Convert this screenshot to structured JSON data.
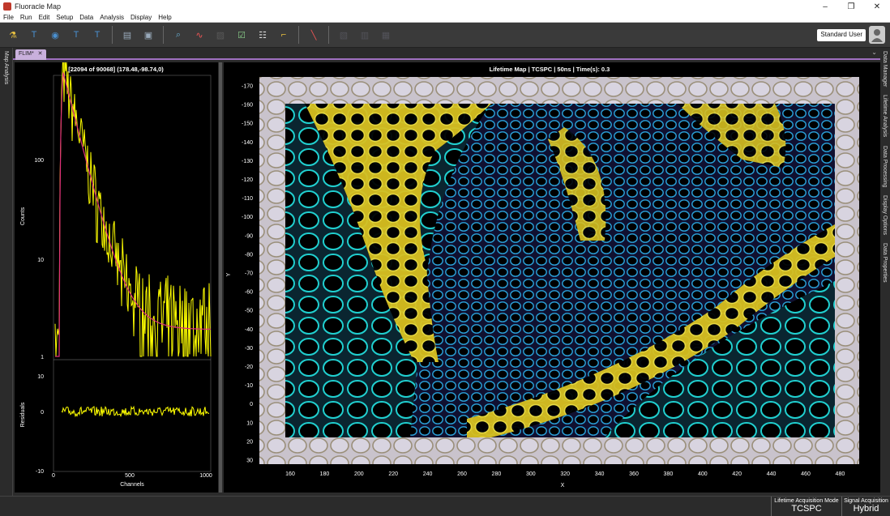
{
  "window": {
    "title": "Fluoracle Map"
  },
  "menu": [
    "File",
    "Run",
    "Edit",
    "Setup",
    "Data",
    "Analysis",
    "Display",
    "Help"
  ],
  "toolbar": {
    "user_label": "Standard User",
    "tools": [
      {
        "icon": "microscope-icon",
        "glyph": "⚗",
        "color": "#e8c040"
      },
      {
        "icon": "timer-t-icon",
        "glyph": "T",
        "color": "#4a90d0"
      },
      {
        "icon": "timer-record-icon",
        "glyph": "◉",
        "color": "#4a90d0"
      },
      {
        "icon": "timer-t2-icon",
        "glyph": "T",
        "color": "#4a90d0"
      },
      {
        "icon": "timer-t3-icon",
        "glyph": "T",
        "color": "#4a90d0"
      },
      {
        "sep": true
      },
      {
        "icon": "open-folder-icon",
        "glyph": "▤",
        "color": "#9ab"
      },
      {
        "icon": "save-disk-icon",
        "glyph": "▣",
        "color": "#9ab"
      },
      {
        "sep": true
      },
      {
        "icon": "zoom-search-icon",
        "glyph": "⌕",
        "color": "#6ac"
      },
      {
        "icon": "decay-fit-icon",
        "glyph": "∿",
        "color": "#e55"
      },
      {
        "icon": "chart-dim-icon",
        "glyph": "▨",
        "color": "#888",
        "dim": true
      },
      {
        "icon": "checklist-icon",
        "glyph": "☑",
        "color": "#8c8"
      },
      {
        "icon": "table-icon",
        "glyph": "☷",
        "color": "#ddd"
      },
      {
        "icon": "crop-icon",
        "glyph": "⌐",
        "color": "#e8c040"
      },
      {
        "sep": true
      },
      {
        "icon": "decay-curve-icon",
        "glyph": "╲",
        "color": "#e55"
      },
      {
        "sep": true
      },
      {
        "icon": "layer-1-icon",
        "glyph": "▧",
        "color": "#778",
        "dim": true
      },
      {
        "icon": "layer-2-icon",
        "glyph": "▥",
        "color": "#778",
        "dim": true
      },
      {
        "icon": "layer-3-icon",
        "glyph": "▦",
        "color": "#778",
        "dim": true
      }
    ]
  },
  "left_rail": {
    "label": "Map Analysis"
  },
  "right_rail": [
    "Data Manager",
    "Lifetime Analysis",
    "Data Processing",
    "Display Options",
    "Data Properties"
  ],
  "tab": {
    "label": "FLIM*",
    "close": "✕",
    "chevron": "⌄"
  },
  "decay_plot": {
    "title": "[22094 of 90068] (178.48,-98.74,0)",
    "ylabel": "Counts",
    "residual_label": "Residuals",
    "xlabel": "Channels",
    "y_ticks": [
      "100",
      "10",
      "1"
    ],
    "res_ticks": [
      "10",
      "0",
      "-10"
    ],
    "x_ticks": [
      "0",
      "500",
      "1000"
    ]
  },
  "map_plot": {
    "title": "Lifetime Map | TCSPC | 50ns | Time(s): 0.3",
    "xlabel": "X",
    "ylabel": "Y",
    "y_ticks": [
      "-170",
      "-160",
      "-150",
      "-140",
      "-130",
      "-120",
      "-110",
      "-100",
      "-90",
      "-80",
      "-70",
      "-60",
      "-50",
      "-40",
      "-30",
      "-20",
      "-10",
      "0",
      "10",
      "20",
      "30"
    ],
    "x_ticks": [
      "160",
      "180",
      "200",
      "220",
      "240",
      "260",
      "280",
      "300",
      "320",
      "340",
      "360",
      "380",
      "400",
      "420",
      "440",
      "460",
      "480"
    ]
  },
  "status": {
    "mode_label": "Lifetime Acquisition Mode",
    "mode_value": "TCSPC",
    "signal_label": "Signal Acquisition",
    "signal_value": "Hybrid"
  },
  "colors": {
    "trace": "#ffff00",
    "fit": "#e0307a",
    "accent": "#a070c0"
  }
}
